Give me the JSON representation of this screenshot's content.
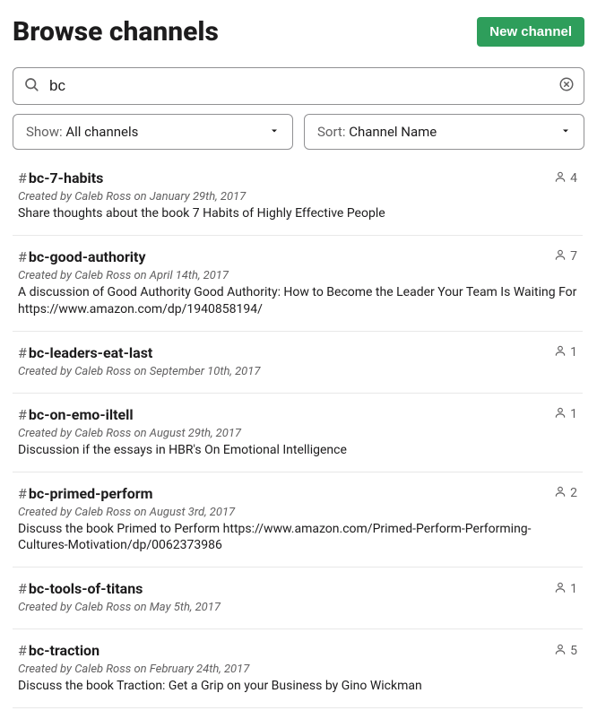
{
  "header": {
    "title": "Browse channels",
    "new_channel_label": "New channel"
  },
  "search": {
    "value": "bc"
  },
  "filters": {
    "show": {
      "label": "Show:",
      "value": "All channels"
    },
    "sort": {
      "label": "Sort:",
      "value": "Channel Name"
    }
  },
  "channels": [
    {
      "name": "bc-7-habits",
      "members": "4",
      "meta": "Created by Caleb Ross on January 29th, 2017",
      "desc": "Share thoughts about the book 7 Habits of Highly Effective People"
    },
    {
      "name": "bc-good-authority",
      "members": "7",
      "meta": "Created by Caleb Ross on April 14th, 2017",
      "desc": "A discussion of Good Authority Good Authority: How to Become the Leader Your Team Is Waiting For https://www.amazon.com/dp/1940858194/"
    },
    {
      "name": "bc-leaders-eat-last",
      "members": "1",
      "meta": "Created by Caleb Ross on September 10th, 2017",
      "desc": ""
    },
    {
      "name": "bc-on-emo-iltell",
      "members": "1",
      "meta": "Created by Caleb Ross on August 29th, 2017",
      "desc": "Discussion if the essays in HBR's On Emotional Intelligence"
    },
    {
      "name": "bc-primed-perform",
      "members": "2",
      "meta": "Created by Caleb Ross on August 3rd, 2017",
      "desc": "Discuss the book Primed to Perform https://www.amazon.com/Primed-Perform-Performing-Cultures-Motivation/dp/0062373986"
    },
    {
      "name": "bc-tools-of-titans",
      "members": "1",
      "meta": "Created by Caleb Ross on May 5th, 2017",
      "desc": ""
    },
    {
      "name": "bc-traction",
      "members": "5",
      "meta": "Created by Caleb Ross on February 24th, 2017",
      "desc": "Discuss the book Traction: Get a Grip on your Business by Gino Wickman"
    }
  ]
}
